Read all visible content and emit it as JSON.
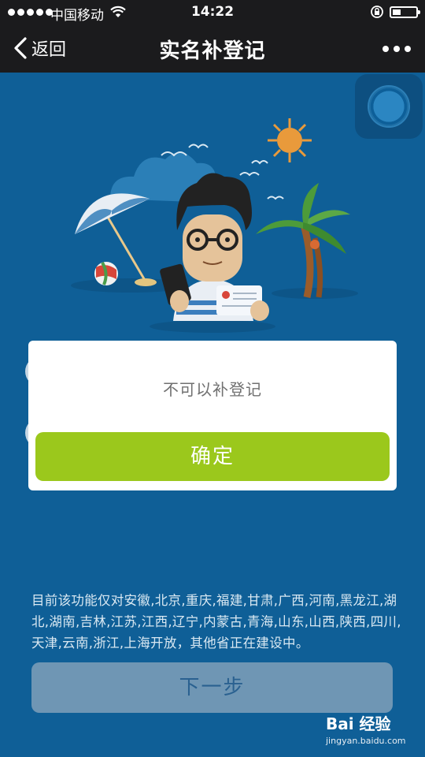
{
  "status_bar": {
    "carrier": "中国移动",
    "time": "14:22"
  },
  "nav": {
    "back_label": "返回",
    "title": "实名补登记"
  },
  "notice_text": "目前该功能仅对安徽,北京,重庆,福建,甘肃,广西,河南,黑龙江,湖北,湖南,吉林,江苏,江西,辽宁,内蒙古,青海,山东,山西,陕西,四川,天津,云南,浙江,上海开放，其他省正在建设中。",
  "next_button_label": "下一步",
  "dialog": {
    "message": "不可以补登记",
    "confirm_label": "确定"
  },
  "watermark": {
    "brand": "Bai 经验",
    "url": "jingyan.baidu.com"
  },
  "colors": {
    "background": "#0f5f97",
    "confirm_button": "#9bc81c",
    "next_button": "#6f96b4",
    "nav_bar": "#1b1b1d"
  }
}
